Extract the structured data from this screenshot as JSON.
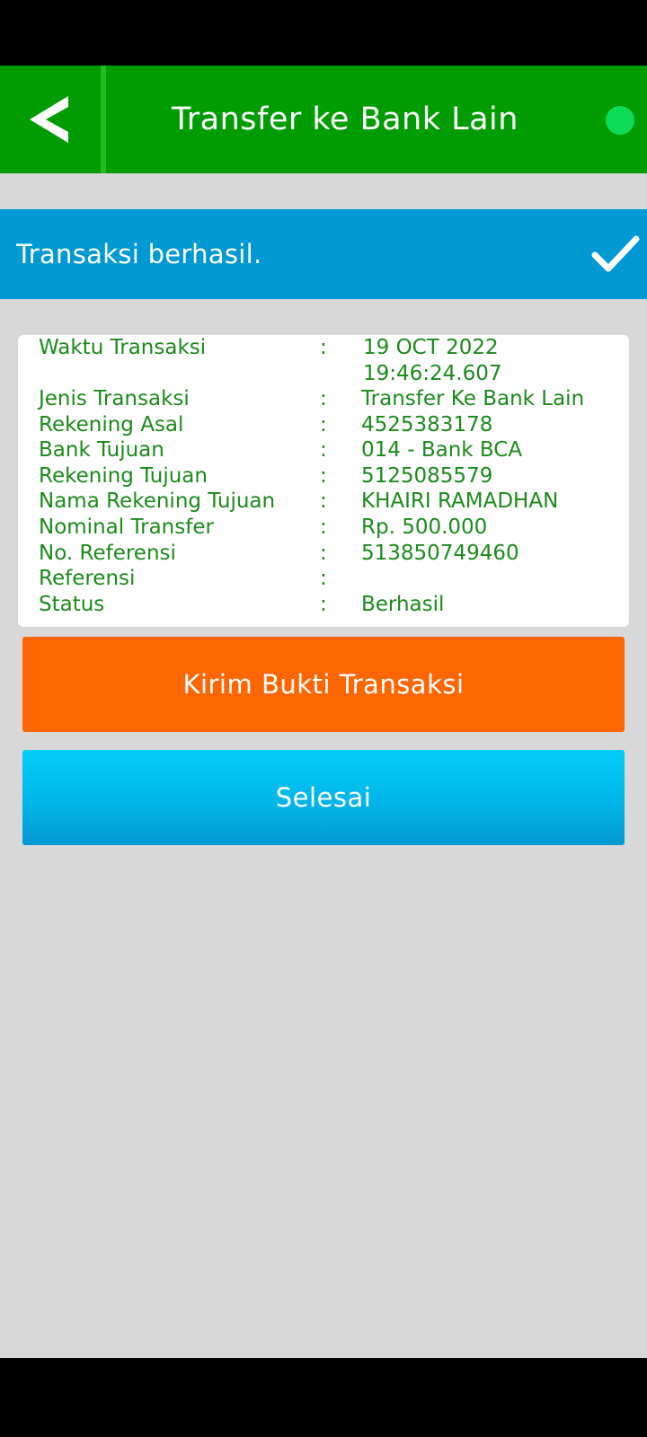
{
  "app_bar": {
    "title": "Transfer ke Bank Lain",
    "back_icon": "chevron-left-icon",
    "status_dot_color": "#0ddb58",
    "background_color": "#019c01"
  },
  "banner": {
    "message": "Transaksi berhasil.",
    "icon": "check-icon",
    "background_color": "#0199d3"
  },
  "details": {
    "rows": [
      {
        "label": "Waktu Transaksi",
        "colon": ":",
        "value_line1": "19 OCT 2022",
        "value_line2": "19:46:24.607"
      },
      {
        "label": "Jenis Transaksi",
        "colon": ":",
        "value": "Transfer Ke Bank Lain"
      },
      {
        "label": "Rekening Asal",
        "colon": ":",
        "value": "4525383178"
      },
      {
        "label": "Bank Tujuan",
        "colon": ":",
        "value": "014 - Bank BCA"
      },
      {
        "label": "Rekening Tujuan",
        "colon": ":",
        "value": "5125085579"
      },
      {
        "label": "Nama Rekening Tujuan",
        "colon": ":",
        "value": "KHAIRI RAMADHAN"
      },
      {
        "label": "Nominal Transfer",
        "colon": ":",
        "value": "Rp. 500.000"
      },
      {
        "label": "No. Referensi",
        "colon": ":",
        "value": "513850749460"
      },
      {
        "label": "Referensi",
        "colon": ":",
        "value": ""
      },
      {
        "label": "Status",
        "colon": ":",
        "value": "Berhasil"
      }
    ],
    "text_color": "#1b8a1b"
  },
  "actions": {
    "kirim_label": "Kirim Bukti Transaksi",
    "kirim_color": "#ff6600",
    "selesai_label": "Selesai",
    "selesai_color": "#02b3e6"
  }
}
